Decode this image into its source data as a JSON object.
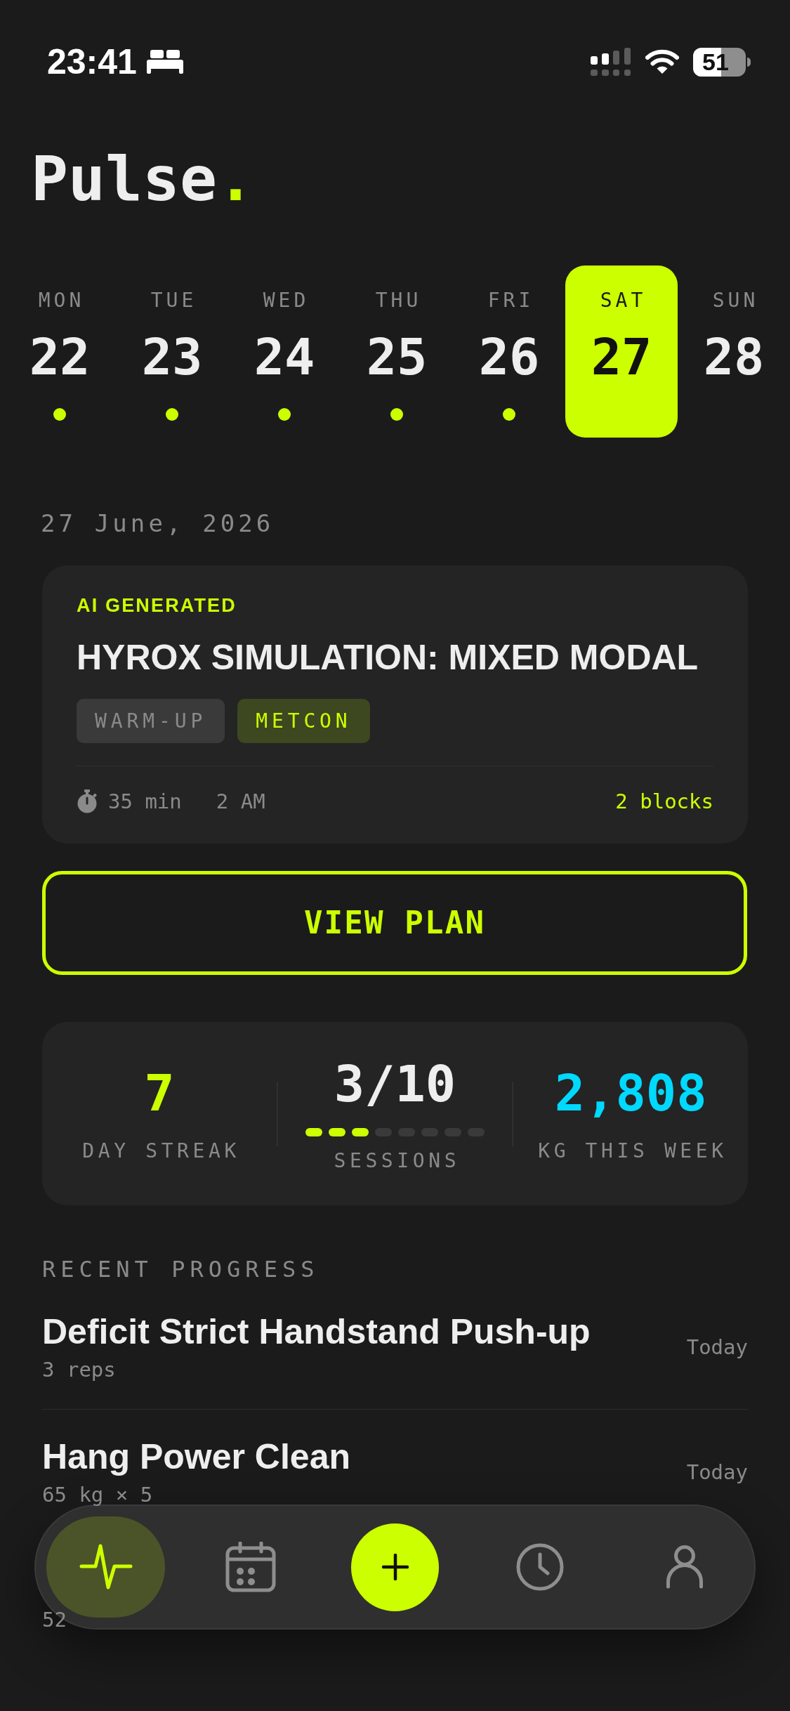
{
  "status_bar": {
    "time": "23:41",
    "battery": "51"
  },
  "header": {
    "title": "Pulse",
    "accent": "."
  },
  "week": [
    {
      "day": "MON",
      "date": "22",
      "selected": false,
      "has_activity": true
    },
    {
      "day": "TUE",
      "date": "23",
      "selected": false,
      "has_activity": true
    },
    {
      "day": "WED",
      "date": "24",
      "selected": false,
      "has_activity": true
    },
    {
      "day": "THU",
      "date": "25",
      "selected": false,
      "has_activity": true
    },
    {
      "day": "FRI",
      "date": "26",
      "selected": false,
      "has_activity": true
    },
    {
      "day": "SAT",
      "date": "27",
      "selected": true,
      "has_activity": false
    },
    {
      "day": "SUN",
      "date": "28",
      "selected": false,
      "has_activity": false
    }
  ],
  "selected_date": "27 June, 2026",
  "workout_card": {
    "badge": "AI GENERATED",
    "title": "HYROX SIMULATION: MIXED MODAL",
    "tags": [
      {
        "label": "WARM-UP",
        "highlighted": false
      },
      {
        "label": "METCON",
        "highlighted": true
      }
    ],
    "duration": "35 min",
    "time": "2 AM",
    "blocks": "2 blocks"
  },
  "primary_button": "VIEW PLAN",
  "stats": [
    {
      "value": "7",
      "label": "DAY STREAK",
      "color": "#ccff00"
    },
    {
      "value": "3/10",
      "label": "SESSIONS",
      "color": "#eeeeee",
      "segments": [
        {
          "filled": true
        },
        {
          "filled": true
        },
        {
          "filled": true
        },
        {
          "filled": false
        },
        {
          "filled": false
        },
        {
          "filled": false
        },
        {
          "filled": false
        },
        {
          "filled": false
        }
      ]
    },
    {
      "value": "2,808",
      "label": "KG THIS WEEK",
      "color": "#00d9ff"
    }
  ],
  "recent_progress": {
    "heading": "RECENT PROGRESS",
    "items": [
      {
        "title": "Deficit Strict Handstand Push-up",
        "detail": "3 reps",
        "when": "Today"
      },
      {
        "title": "Hang Power Clean",
        "detail": "65 kg × 5",
        "when": "Today"
      },
      {
        "detail": "52"
      }
    ]
  },
  "tab_bar": [
    {
      "kind": "tab",
      "selected": true
    },
    {
      "kind": "tab",
      "selected": false
    },
    {
      "kind": "action"
    },
    {
      "kind": "tab",
      "selected": false
    },
    {
      "kind": "tab",
      "selected": false
    }
  ]
}
